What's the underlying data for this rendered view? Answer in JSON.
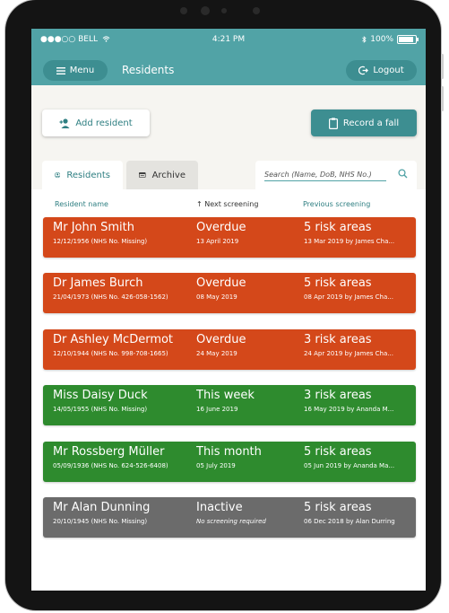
{
  "colors": {
    "teal": "#51a3a6",
    "teal_dark": "#3d8e91",
    "overdue": "#d4481a",
    "this_week": "#2e8b2e",
    "this_month": "#2e8b2e",
    "inactive": "#6b6b6b"
  },
  "status_bar": {
    "carrier": "●●●○○ BELL",
    "time": "4:21 PM",
    "battery": "100%"
  },
  "header": {
    "menu_label": "Menu",
    "title": "Residents",
    "logout_label": "Logout"
  },
  "actions": {
    "add_resident": "Add resident",
    "record_fall": "Record a fall"
  },
  "tabs": [
    {
      "label": "Residents",
      "icon": "person-circle-icon",
      "active": true
    },
    {
      "label": "Archive",
      "icon": "archive-icon",
      "active": false
    }
  ],
  "search": {
    "placeholder": "Search (Name, DoB, NHS No.)"
  },
  "columns": {
    "name": "Resident name",
    "next": "↑ Next screening",
    "previous": "Previous screening"
  },
  "residents": [
    {
      "name": "Mr John Smith",
      "details": "12/12/1956 (NHS No. Missing)",
      "next": "Overdue",
      "next_date": "13 April 2019",
      "previous": "5 risk areas",
      "previous_detail": "13 Mar 2019 by James Cha...",
      "status": "overdue"
    },
    {
      "name": "Dr James Burch",
      "details": "21/04/1973 (NHS No. 426-058-1562)",
      "next": "Overdue",
      "next_date": "08 May 2019",
      "previous": "5 risk areas",
      "previous_detail": "08 Apr 2019 by James Cha...",
      "status": "overdue"
    },
    {
      "name": "Dr Ashley McDermot",
      "details": "12/10/1944 (NHS No. 998-708-1665)",
      "next": "Overdue",
      "next_date": "24 May 2019",
      "previous": "3 risk areas",
      "previous_detail": "24 Apr 2019 by James Cha...",
      "status": "overdue"
    },
    {
      "name": "Miss Daisy Duck",
      "details": "14/05/1955 (NHS No. Missing)",
      "next": "This week",
      "next_date": "16 June 2019",
      "previous": "3 risk areas",
      "previous_detail": "16 May 2019 by Ananda M...",
      "status": "this_week"
    },
    {
      "name": "Mr Rossberg Müller",
      "details": "05/09/1936 (NHS No. 624-526-6408)",
      "next": "This month",
      "next_date": "05 July 2019",
      "previous": "5 risk areas",
      "previous_detail": "05 Jun 2019 by Ananda Ma...",
      "status": "this_month"
    },
    {
      "name": "Mr Alan Dunning",
      "details": "20/10/1945 (NHS No. Missing)",
      "next": "Inactive",
      "next_date": "No screening required",
      "previous": "5 risk areas",
      "previous_detail": "06 Dec 2018 by Alan Durring",
      "status": "inactive"
    }
  ]
}
